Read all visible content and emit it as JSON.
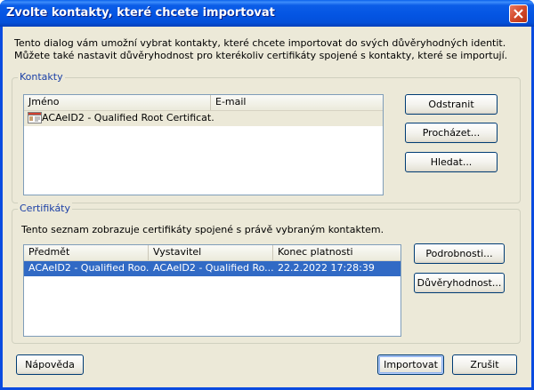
{
  "window": {
    "title": "Zvolte kontakty, které chcete importovat"
  },
  "intro": "Tento dialog vám umožní vybrat kontakty, které chcete importovat do svých důvěryhodných identit. Můžete také nastavit důvěryhodnost pro kterékoliv certifikáty spojené s kontakty, které se importují.",
  "contacts": {
    "group_label": "Kontakty",
    "columns": [
      "Jméno",
      "E-mail"
    ],
    "rows": [
      {
        "name": "ACAeID2 - Qualified Root Certificat...",
        "email": ""
      }
    ],
    "buttons": {
      "remove": "Odstranit",
      "browse": "Procházet...",
      "search": "Hledat..."
    }
  },
  "certificates": {
    "group_label": "Certifikáty",
    "description": "Tento seznam zobrazuje certifikáty spojené s právě vybraným kontaktem.",
    "columns": [
      "Předmět",
      "Vystavitel",
      "Konec platnosti"
    ],
    "rows": [
      {
        "subject": "ACAeID2 - Qualified Roo...",
        "issuer": "ACAeID2 - Qualified Ro...",
        "expires": "22.2.2022 17:28:39"
      }
    ],
    "buttons": {
      "details": "Podrobnosti...",
      "trust": "Důvěryhodnost..."
    }
  },
  "footer": {
    "help": "Nápověda",
    "import": "Importovat",
    "cancel": "Zrušit"
  },
  "colors": {
    "titlebar": "#0454e2",
    "selection": "#316ac5",
    "group_label": "#1a3fa6",
    "face": "#ece9d8"
  },
  "icons": {
    "close": "close-icon",
    "contact": "contact-card-icon"
  }
}
